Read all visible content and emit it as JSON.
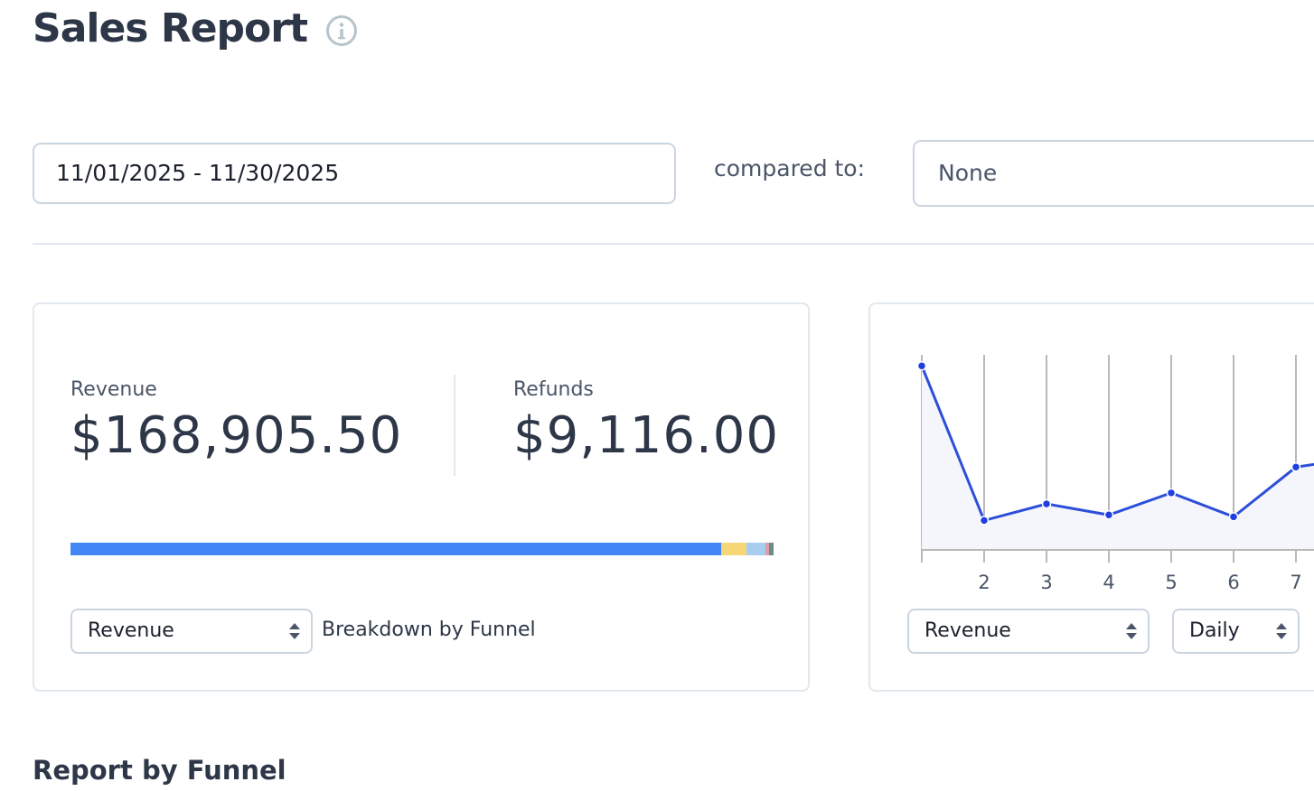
{
  "header": {
    "title": "Sales Report",
    "info_icon": "info-icon"
  },
  "filters": {
    "date_range": "11/01/2025 - 11/30/2025",
    "compared_label": "compared to:",
    "compared_value": "None"
  },
  "summary": {
    "revenue_label": "Revenue",
    "revenue_value": "$168,905.50",
    "refunds_label": "Refunds",
    "refunds_value": "$9,116.00",
    "breakdown_fractions": [
      {
        "color": "#4285f4",
        "fraction": 0.926
      },
      {
        "color": "#f7d675",
        "fraction": 0.036
      },
      {
        "color": "#a7cdf0",
        "fraction": 0.026
      },
      {
        "color": "#d9a0a6",
        "fraction": 0.005
      },
      {
        "color": "#6d8c85",
        "fraction": 0.007
      }
    ],
    "metric_select": "Revenue",
    "breakdown_label": "Breakdown by Funnel"
  },
  "chart_panel": {
    "metric_select": "Revenue",
    "interval_select": "Daily"
  },
  "chart_data": {
    "type": "area",
    "categories": [
      "",
      "2",
      "3",
      "4",
      "5",
      "6",
      "7",
      ""
    ],
    "values": [
      100,
      16,
      25,
      19,
      31,
      18,
      45,
      50
    ],
    "ylim": [
      0,
      105
    ],
    "line_color": "#2d4fd8",
    "fill_color": "#f5f5fc",
    "grid": "vertical",
    "legend": "none"
  },
  "footer": {
    "section_title": "Report by Funnel"
  }
}
